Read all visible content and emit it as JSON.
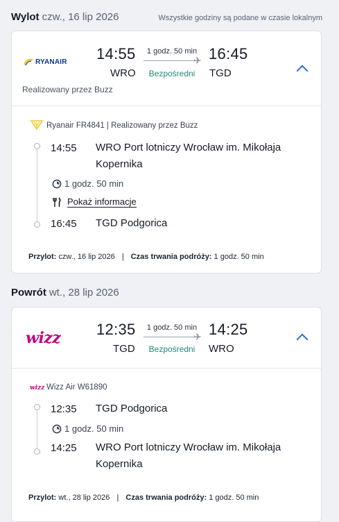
{
  "outbound": {
    "label": "Wylot",
    "date": "czw., 16 lip 2026",
    "timezone_note": "Wszystkie godziny są podane w czasie lokalnym",
    "airline_logo_text": "RYANAIR",
    "dep_time": "14:55",
    "arr_time": "16:45",
    "dep_iata": "WRO",
    "arr_iata": "TGD",
    "duration": "1 godz. 50 min",
    "stops": "Bezpośredni",
    "operated_by": "Realizowany przez Buzz",
    "flight_line": "Ryanair FR4841 | Realizowany przez Buzz",
    "detail_dep_time": "14:55",
    "detail_dep_place_line1": "WRO Port lotniczy Wrocław im. Mikołaja",
    "detail_dep_place_line2": "Kopernika",
    "detail_duration": "1 godz. 50 min",
    "info_link": "Pokaż informacje",
    "detail_arr_time": "16:45",
    "detail_arr_place": "TGD Podgorica",
    "footer_arrival_label": "Przylot:",
    "footer_arrival_value": "czw., 16 lip 2026",
    "footer_separator": "|",
    "footer_duration_label": "Czas trwania podróży:",
    "footer_duration_value": "1 godz. 50 min"
  },
  "return": {
    "label": "Powrót",
    "date": "wt., 28 lip 2026",
    "airline_logo_text": "wizz",
    "dep_time": "12:35",
    "arr_time": "14:25",
    "dep_iata": "TGD",
    "arr_iata": "WRO",
    "duration": "1 godz. 50 min",
    "stops": "Bezpośredni",
    "flight_line": "Wizz Air W61890",
    "detail_dep_time": "12:35",
    "detail_dep_place": "TGD Podgorica",
    "detail_duration": "1 godz. 50 min",
    "detail_arr_time": "14:25",
    "detail_arr_place_line1": "WRO Port lotniczy Wrocław im. Mikołaja",
    "detail_arr_place_line2": "Kopernika",
    "footer_arrival_label": "Przylot:",
    "footer_arrival_value": "wt., 28 lip 2026",
    "footer_separator": "|",
    "footer_duration_label": "Czas trwania podróży:",
    "footer_duration_value": "1 godz. 50 min"
  },
  "colors": {
    "accent": "#2a6bd6",
    "direct": "#1b8a7a",
    "ryanair_blue": "#073590",
    "ryanair_yellow": "#f1c933",
    "wizz_pink": "#c6007e",
    "wizz_purple": "#4b2a85"
  },
  "icons": {
    "expand": "chevron-up-icon",
    "plane": "plane-icon",
    "clock": "clock-icon",
    "meal": "fork-knife-icon"
  }
}
